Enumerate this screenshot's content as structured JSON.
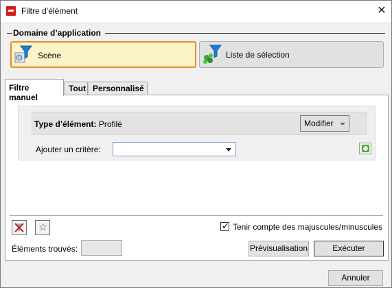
{
  "window": {
    "title": "Filtre d’élément",
    "close_glyph": "✕"
  },
  "scope_group": {
    "title": "Domaine d’application",
    "buttons": [
      {
        "label": "Scène",
        "icon": "scene-filter-icon",
        "selected": true
      },
      {
        "label": "Liste de sélection",
        "icon": "selection-list-filter-icon",
        "selected": false
      }
    ]
  },
  "tabs": [
    {
      "label": "Filtre manuel",
      "selected": true
    },
    {
      "label": "Tout",
      "selected": false
    },
    {
      "label": "Personnalisé",
      "selected": false
    }
  ],
  "manual": {
    "type_label": "Type d’élément:",
    "type_value": "Profilé",
    "modify_label": "Modifier",
    "add_criterion_label": "Ajouter un critère:",
    "add_criterion_value": ""
  },
  "footer": {
    "case_sensitive_label": "Tenir compte des majuscules/minuscules",
    "case_sensitive_checked": true,
    "found_label": "Éléments trouvés:",
    "found_value": "",
    "preview_label": "Prévisualisation",
    "execute_label": "Exécuter",
    "cancel_label": "Annuler"
  },
  "colors": {
    "selected_bg": "#fcf3c6",
    "selected_border": "#e88b2e",
    "funnel_blue": "#1a7fd4"
  }
}
